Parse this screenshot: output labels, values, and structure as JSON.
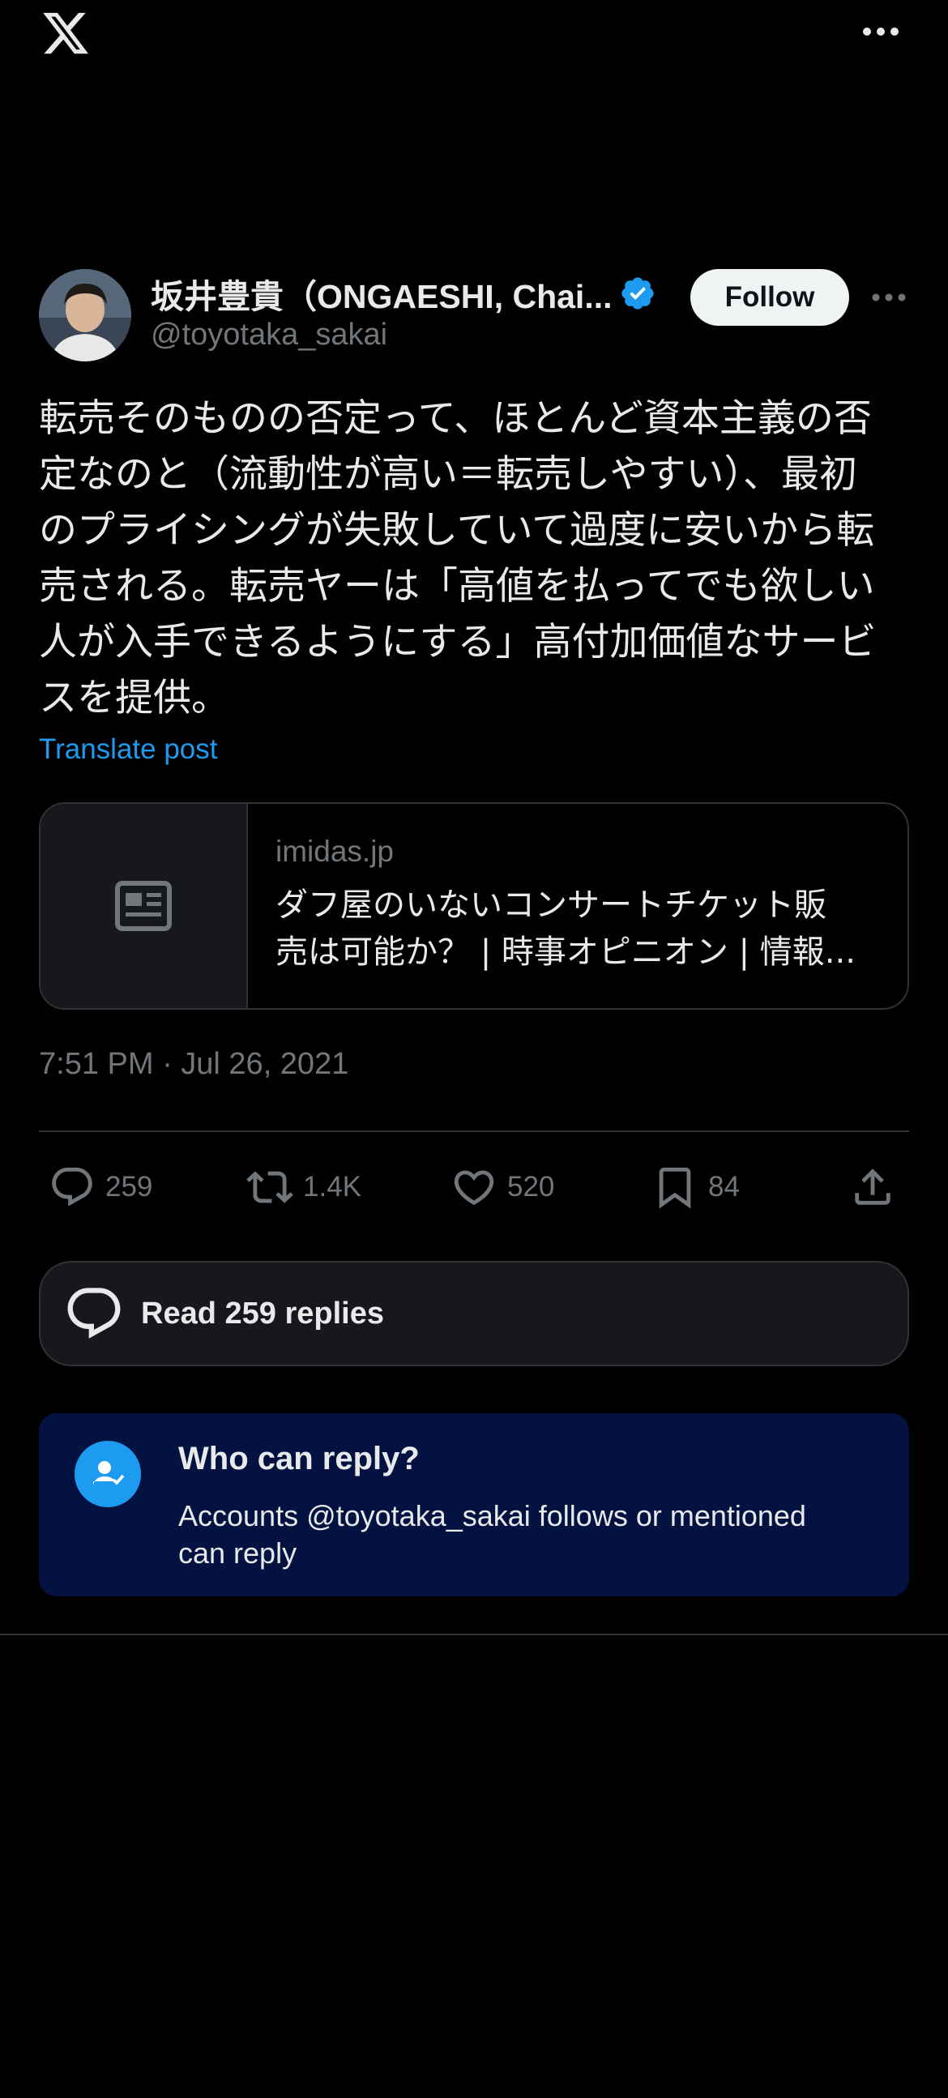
{
  "header": {
    "logo_icon": "x-logo-icon",
    "more_icon": "more-horizontal-icon"
  },
  "author": {
    "display_name": "坂井豊貴（ONGAESHI, Chai...",
    "handle": "@toyotaka_sakai",
    "verified_icon": "verified-badge-icon",
    "follow_label": "Follow"
  },
  "tweet": {
    "lines": [
      "転売そのものの否定って、ほとんど資本主義の否",
      "定なのと（流動性が高い＝転売しやすい）、最初",
      "のプライシングが失敗していて過度に安いから転",
      "売される。転売ヤーは「高値を払ってでも欲しい",
      "人が入手できるようにする」高付加価値なサービ",
      "スを提供。"
    ],
    "translate_label": "Translate post"
  },
  "link_card": {
    "domain": "imidas.jp",
    "title_lines": [
      "ダフ屋のいないコンサートチケット販",
      "売は可能か？ | 時事オピニオン | 情報..."
    ],
    "thumb_icon": "article-icon"
  },
  "timestamp": "7:51 PM · Jul 26, 2021",
  "metrics": {
    "replies": "259",
    "reposts": "1.4K",
    "likes": "520",
    "bookmarks": "84"
  },
  "read_replies_label": "Read 259 replies",
  "who_can_reply": {
    "title": "Who can reply?",
    "description": "Accounts @toyotaka_sakai follows or mentioned can reply"
  },
  "colors": {
    "background": "#000000",
    "accent": "#1d9bf0",
    "muted": "#71767b",
    "notice_bg": "#031240"
  }
}
